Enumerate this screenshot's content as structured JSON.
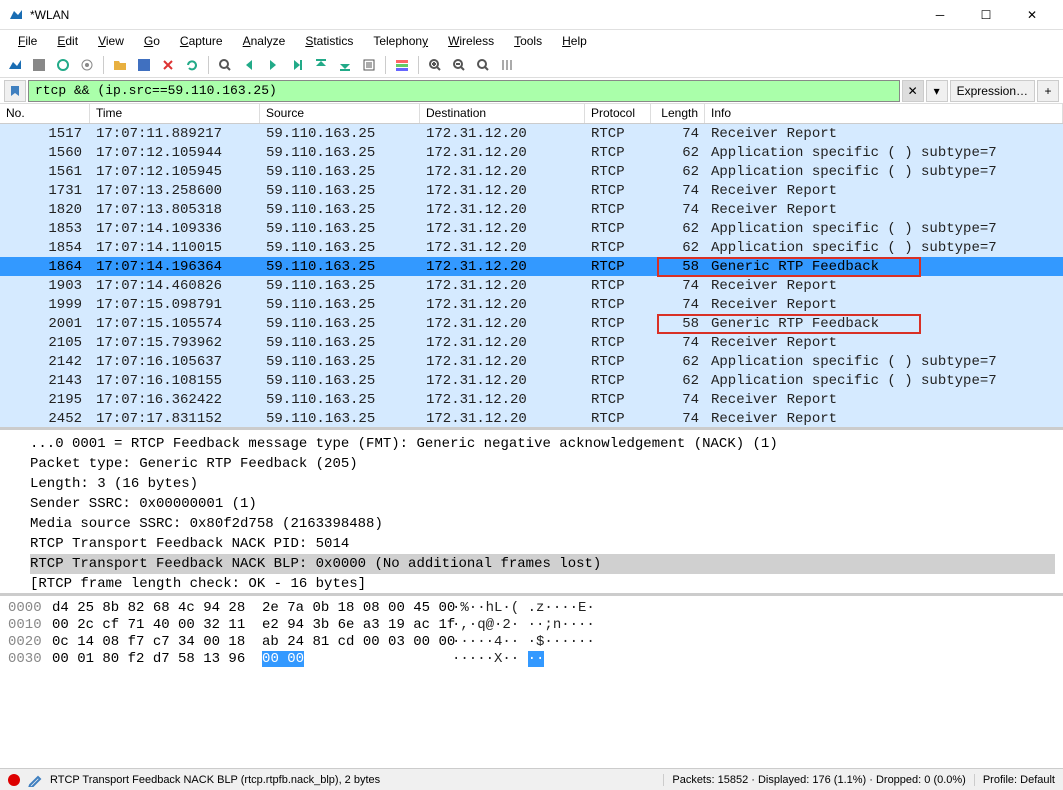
{
  "window": {
    "title": "*WLAN"
  },
  "menu": {
    "file": "File",
    "edit": "Edit",
    "view": "View",
    "go": "Go",
    "capture": "Capture",
    "analyze": "Analyze",
    "statistics": "Statistics",
    "telephony": "Telephony",
    "wireless": "Wireless",
    "tools": "Tools",
    "help": "Help"
  },
  "filter": {
    "value": "rtcp && (ip.src==59.110.163.25)",
    "expression_label": "Expression…"
  },
  "columns": {
    "no": "No.",
    "time": "Time",
    "src": "Source",
    "dst": "Destination",
    "proto": "Protocol",
    "len": "Length",
    "info": "Info"
  },
  "packets": [
    {
      "no": "1517",
      "time": "17:07:11.889217",
      "src": "59.110.163.25",
      "dst": "172.31.12.20",
      "proto": "RTCP",
      "len": "74",
      "info": "Receiver Report"
    },
    {
      "no": "1560",
      "time": "17:07:12.105944",
      "src": "59.110.163.25",
      "dst": "172.31.12.20",
      "proto": "RTCP",
      "len": "62",
      "info": "Application specific  (  ) subtype=7"
    },
    {
      "no": "1561",
      "time": "17:07:12.105945",
      "src": "59.110.163.25",
      "dst": "172.31.12.20",
      "proto": "RTCP",
      "len": "62",
      "info": "Application specific  (  ) subtype=7"
    },
    {
      "no": "1731",
      "time": "17:07:13.258600",
      "src": "59.110.163.25",
      "dst": "172.31.12.20",
      "proto": "RTCP",
      "len": "74",
      "info": "Receiver Report"
    },
    {
      "no": "1820",
      "time": "17:07:13.805318",
      "src": "59.110.163.25",
      "dst": "172.31.12.20",
      "proto": "RTCP",
      "len": "74",
      "info": "Receiver Report"
    },
    {
      "no": "1853",
      "time": "17:07:14.109336",
      "src": "59.110.163.25",
      "dst": "172.31.12.20",
      "proto": "RTCP",
      "len": "62",
      "info": "Application specific  (  ) subtype=7"
    },
    {
      "no": "1854",
      "time": "17:07:14.110015",
      "src": "59.110.163.25",
      "dst": "172.31.12.20",
      "proto": "RTCP",
      "len": "62",
      "info": "Application specific  (  ) subtype=7"
    },
    {
      "no": "1864",
      "time": "17:07:14.196364",
      "src": "59.110.163.25",
      "dst": "172.31.12.20",
      "proto": "RTCP",
      "len": "58",
      "info": "Generic RTP Feedback",
      "sel": true
    },
    {
      "no": "1903",
      "time": "17:07:14.460826",
      "src": "59.110.163.25",
      "dst": "172.31.12.20",
      "proto": "RTCP",
      "len": "74",
      "info": "Receiver Report"
    },
    {
      "no": "1999",
      "time": "17:07:15.098791",
      "src": "59.110.163.25",
      "dst": "172.31.12.20",
      "proto": "RTCP",
      "len": "74",
      "info": "Receiver Report"
    },
    {
      "no": "2001",
      "time": "17:07:15.105574",
      "src": "59.110.163.25",
      "dst": "172.31.12.20",
      "proto": "RTCP",
      "len": "58",
      "info": "Generic RTP Feedback"
    },
    {
      "no": "2105",
      "time": "17:07:15.793962",
      "src": "59.110.163.25",
      "dst": "172.31.12.20",
      "proto": "RTCP",
      "len": "74",
      "info": "Receiver Report"
    },
    {
      "no": "2142",
      "time": "17:07:16.105637",
      "src": "59.110.163.25",
      "dst": "172.31.12.20",
      "proto": "RTCP",
      "len": "62",
      "info": "Application specific  (  ) subtype=7"
    },
    {
      "no": "2143",
      "time": "17:07:16.108155",
      "src": "59.110.163.25",
      "dst": "172.31.12.20",
      "proto": "RTCP",
      "len": "62",
      "info": "Application specific  (  ) subtype=7"
    },
    {
      "no": "2195",
      "time": "17:07:16.362422",
      "src": "59.110.163.25",
      "dst": "172.31.12.20",
      "proto": "RTCP",
      "len": "74",
      "info": "Receiver Report"
    },
    {
      "no": "2452",
      "time": "17:07:17.831152",
      "src": "59.110.163.25",
      "dst": "172.31.12.20",
      "proto": "RTCP",
      "len": "74",
      "info": "Receiver Report"
    }
  ],
  "details": [
    "...0 0001 = RTCP Feedback message type (FMT): Generic negative acknowledgement (NACK) (1)",
    "Packet type: Generic RTP Feedback (205)",
    "Length: 3 (16 bytes)",
    "Sender SSRC: 0x00000001 (1)",
    "Media source SSRC: 0x80f2d758 (2163398488)",
    "RTCP Transport Feedback NACK PID: 5014",
    "RTCP Transport Feedback NACK BLP: 0x0000 (No additional frames lost)",
    "[RTCP frame length check: OK - 16 bytes]"
  ],
  "details_sel_index": 6,
  "hex": [
    {
      "offset": "0000",
      "bytes": "d4 25 8b 82 68 4c 94 28  2e 7a 0b 18 08 00 45 00",
      "ascii": "·%··hL·( .z····E·"
    },
    {
      "offset": "0010",
      "bytes": "00 2c cf 71 40 00 32 11  e2 94 3b 6e a3 19 ac 1f",
      "ascii": "·,·q@·2· ··;n····"
    },
    {
      "offset": "0020",
      "bytes": "0c 14 08 f7 c7 34 00 18  ab 24 81 cd 00 03 00 00",
      "ascii": "·····4·· ·$······"
    },
    {
      "offset": "0030",
      "bytes_pre": "00 01 80 f2 d7 58 13 96  ",
      "bytes_sel": "00 00",
      "ascii_pre": "·····X·· ",
      "ascii_sel": "··"
    }
  ],
  "status": {
    "field": "RTCP Transport Feedback NACK BLP (rtcp.rtpfb.nack_blp), 2 bytes",
    "packets": "Packets: 15852  · Displayed: 176 (1.1%)  · Dropped: 0 (0.0%)",
    "profile": "Profile: Default"
  }
}
